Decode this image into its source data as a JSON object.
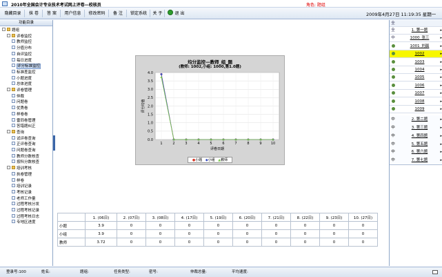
{
  "window": {
    "title": "2010年全国会计专业技术考试网上评卷—校核员",
    "role": "角色: 题组"
  },
  "menu": {
    "items": [
      "隐藏目录",
      "抹 卷",
      "答 案",
      "用户信息",
      "修改密码",
      "备 注",
      "锁定系统",
      "关 于"
    ],
    "exit": "退 出",
    "datetime": "2009年4月27日 11:19:35 星期一"
  },
  "left": {
    "header": "功能目录",
    "tree": [
      {
        "label": "题组",
        "lvl": 0,
        "type": "root"
      },
      {
        "label": "评卷监控",
        "lvl": 1,
        "type": "folder"
      },
      {
        "label": "教师监控",
        "lvl": 2,
        "type": "leaf"
      },
      {
        "label": "分值分布",
        "lvl": 2,
        "type": "leaf"
      },
      {
        "label": "自评监控",
        "lvl": 2,
        "type": "leaf"
      },
      {
        "label": "每日进度",
        "lvl": 2,
        "type": "leaf"
      },
      {
        "label": "评分标准监控",
        "lvl": 2,
        "type": "leaf",
        "sel": true
      },
      {
        "label": "标准差监控",
        "lvl": 2,
        "type": "leaf"
      },
      {
        "label": "小题进度",
        "lvl": 2,
        "type": "leaf"
      },
      {
        "label": "总体进度",
        "lvl": 2,
        "type": "leaf"
      },
      {
        "label": "评卷管理",
        "lvl": 1,
        "type": "folder"
      },
      {
        "label": "仲裁",
        "lvl": 2,
        "type": "leaf"
      },
      {
        "label": "问题卷",
        "lvl": 2,
        "type": "leaf"
      },
      {
        "label": "优秀卷",
        "lvl": 2,
        "type": "leaf"
      },
      {
        "label": "样卷卷",
        "lvl": 2,
        "type": "leaf"
      },
      {
        "label": "雷同卷管理",
        "lvl": 2,
        "type": "leaf"
      },
      {
        "label": "答错题纠正",
        "lvl": 2,
        "type": "leaf"
      },
      {
        "label": "查询",
        "lvl": 1,
        "type": "folder"
      },
      {
        "label": "试评卷查询",
        "lvl": 2,
        "type": "leaf"
      },
      {
        "label": "正评卷查询",
        "lvl": 2,
        "type": "leaf"
      },
      {
        "label": "问题卷查询",
        "lvl": 2,
        "type": "leaf"
      },
      {
        "label": "教师分数核查",
        "lvl": 2,
        "type": "leaf"
      },
      {
        "label": "按科分数核查",
        "lvl": 2,
        "type": "leaf"
      },
      {
        "label": "培训考核",
        "lvl": 1,
        "type": "folder"
      },
      {
        "label": "执卷管理",
        "lvl": 2,
        "type": "leaf"
      },
      {
        "label": "样卷",
        "lvl": 2,
        "type": "leaf"
      },
      {
        "label": "培训记录",
        "lvl": 2,
        "type": "leaf"
      },
      {
        "label": "考核记录",
        "lvl": 2,
        "type": "leaf"
      },
      {
        "label": "老师工作量",
        "lvl": 2,
        "type": "leaf"
      },
      {
        "label": "过程考核分发",
        "lvl": 2,
        "type": "leaf"
      },
      {
        "label": "过程考核记录",
        "lvl": 2,
        "type": "leaf"
      },
      {
        "label": "过程考核日志",
        "lvl": 2,
        "type": "leaf"
      },
      {
        "label": "专地区进度",
        "lvl": 2,
        "type": "leaf"
      }
    ]
  },
  "chart_data": {
    "type": "line",
    "title": "均分监控—教师_组_题",
    "subtitle": "(教师: 1002,小组: 1000,第1.0题)",
    "xlabel": "评卷日期",
    "ylabel": "评分均值",
    "x": [
      1,
      2,
      3,
      4,
      5,
      6,
      7,
      8,
      9,
      10
    ],
    "ylim": [
      0,
      4.0
    ],
    "yticks": [
      "0.0",
      "0.5",
      "1.0",
      "1.5",
      "2.0",
      "2.5",
      "3.0",
      "3.5",
      "4.0"
    ],
    "series": [
      {
        "name": "小题",
        "color": "#d83a2a",
        "values": [
          3.9,
          0,
          0,
          0,
          0,
          0,
          0,
          0,
          0,
          0
        ]
      },
      {
        "name": "小组",
        "color": "#3a4fc0",
        "values": [
          3.9,
          0,
          0,
          0,
          0,
          0,
          0,
          0,
          0,
          0
        ]
      },
      {
        "name": "教师",
        "color": "#7ac84a",
        "values": [
          3.72,
          0,
          0,
          0,
          0,
          0,
          0,
          0,
          0,
          0
        ]
      }
    ]
  },
  "table": {
    "headers": [
      "",
      "1. (06日)",
      "2. (07日)",
      "3. (08日)",
      "4. (17日)",
      "5. (19日)",
      "6. (20日)",
      "7. (21日)",
      "8. (22日)",
      "9. (23日)",
      "10. (27日)"
    ],
    "rows": [
      [
        "小题",
        "3.9",
        "0",
        "0",
        "0",
        "0",
        "0",
        "0",
        "0",
        "0",
        "0"
      ],
      [
        "小组",
        "3.9",
        "0",
        "0",
        "0",
        "0",
        "0",
        "0",
        "0",
        "0",
        "0"
      ],
      [
        "教师",
        "3.72",
        "0",
        "0",
        "0",
        "0",
        "0",
        "0",
        "0",
        "0",
        "0"
      ]
    ]
  },
  "right": {
    "header": "全",
    "users": [
      {
        "st": "全",
        "name": "1. 第一题",
        "kind": "group"
      },
      {
        "st": "中",
        "name": "1000_张三",
        "kind": "group"
      },
      {
        "name": "1001_刘晨",
        "kind": "user"
      },
      {
        "name": "1002",
        "kind": "user",
        "hl": true
      },
      {
        "name": "1003",
        "kind": "user"
      },
      {
        "name": "1004",
        "kind": "user"
      },
      {
        "name": "1005",
        "kind": "user"
      },
      {
        "name": "1006",
        "kind": "user"
      },
      {
        "name": "1007",
        "kind": "user"
      },
      {
        "name": "1008",
        "kind": "user"
      },
      {
        "name": "1009",
        "kind": "user"
      }
    ],
    "groups": [
      {
        "st": "中",
        "name": "2. 第二题"
      },
      {
        "st": "中",
        "name": "3. 第三题"
      },
      {
        "st": "中",
        "name": "4. 第四题"
      },
      {
        "st": "中",
        "name": "5. 第五题"
      },
      {
        "st": "中",
        "name": "6. 第六题"
      },
      {
        "st": "中",
        "name": "7. 第七题"
      }
    ]
  },
  "status": {
    "login": "登录号:100",
    "name": "姓名:",
    "group": "题组:",
    "task": "任务类型:",
    "paper": "密号:",
    "total": "仲裁总量:",
    "avg": "平均速度:"
  }
}
